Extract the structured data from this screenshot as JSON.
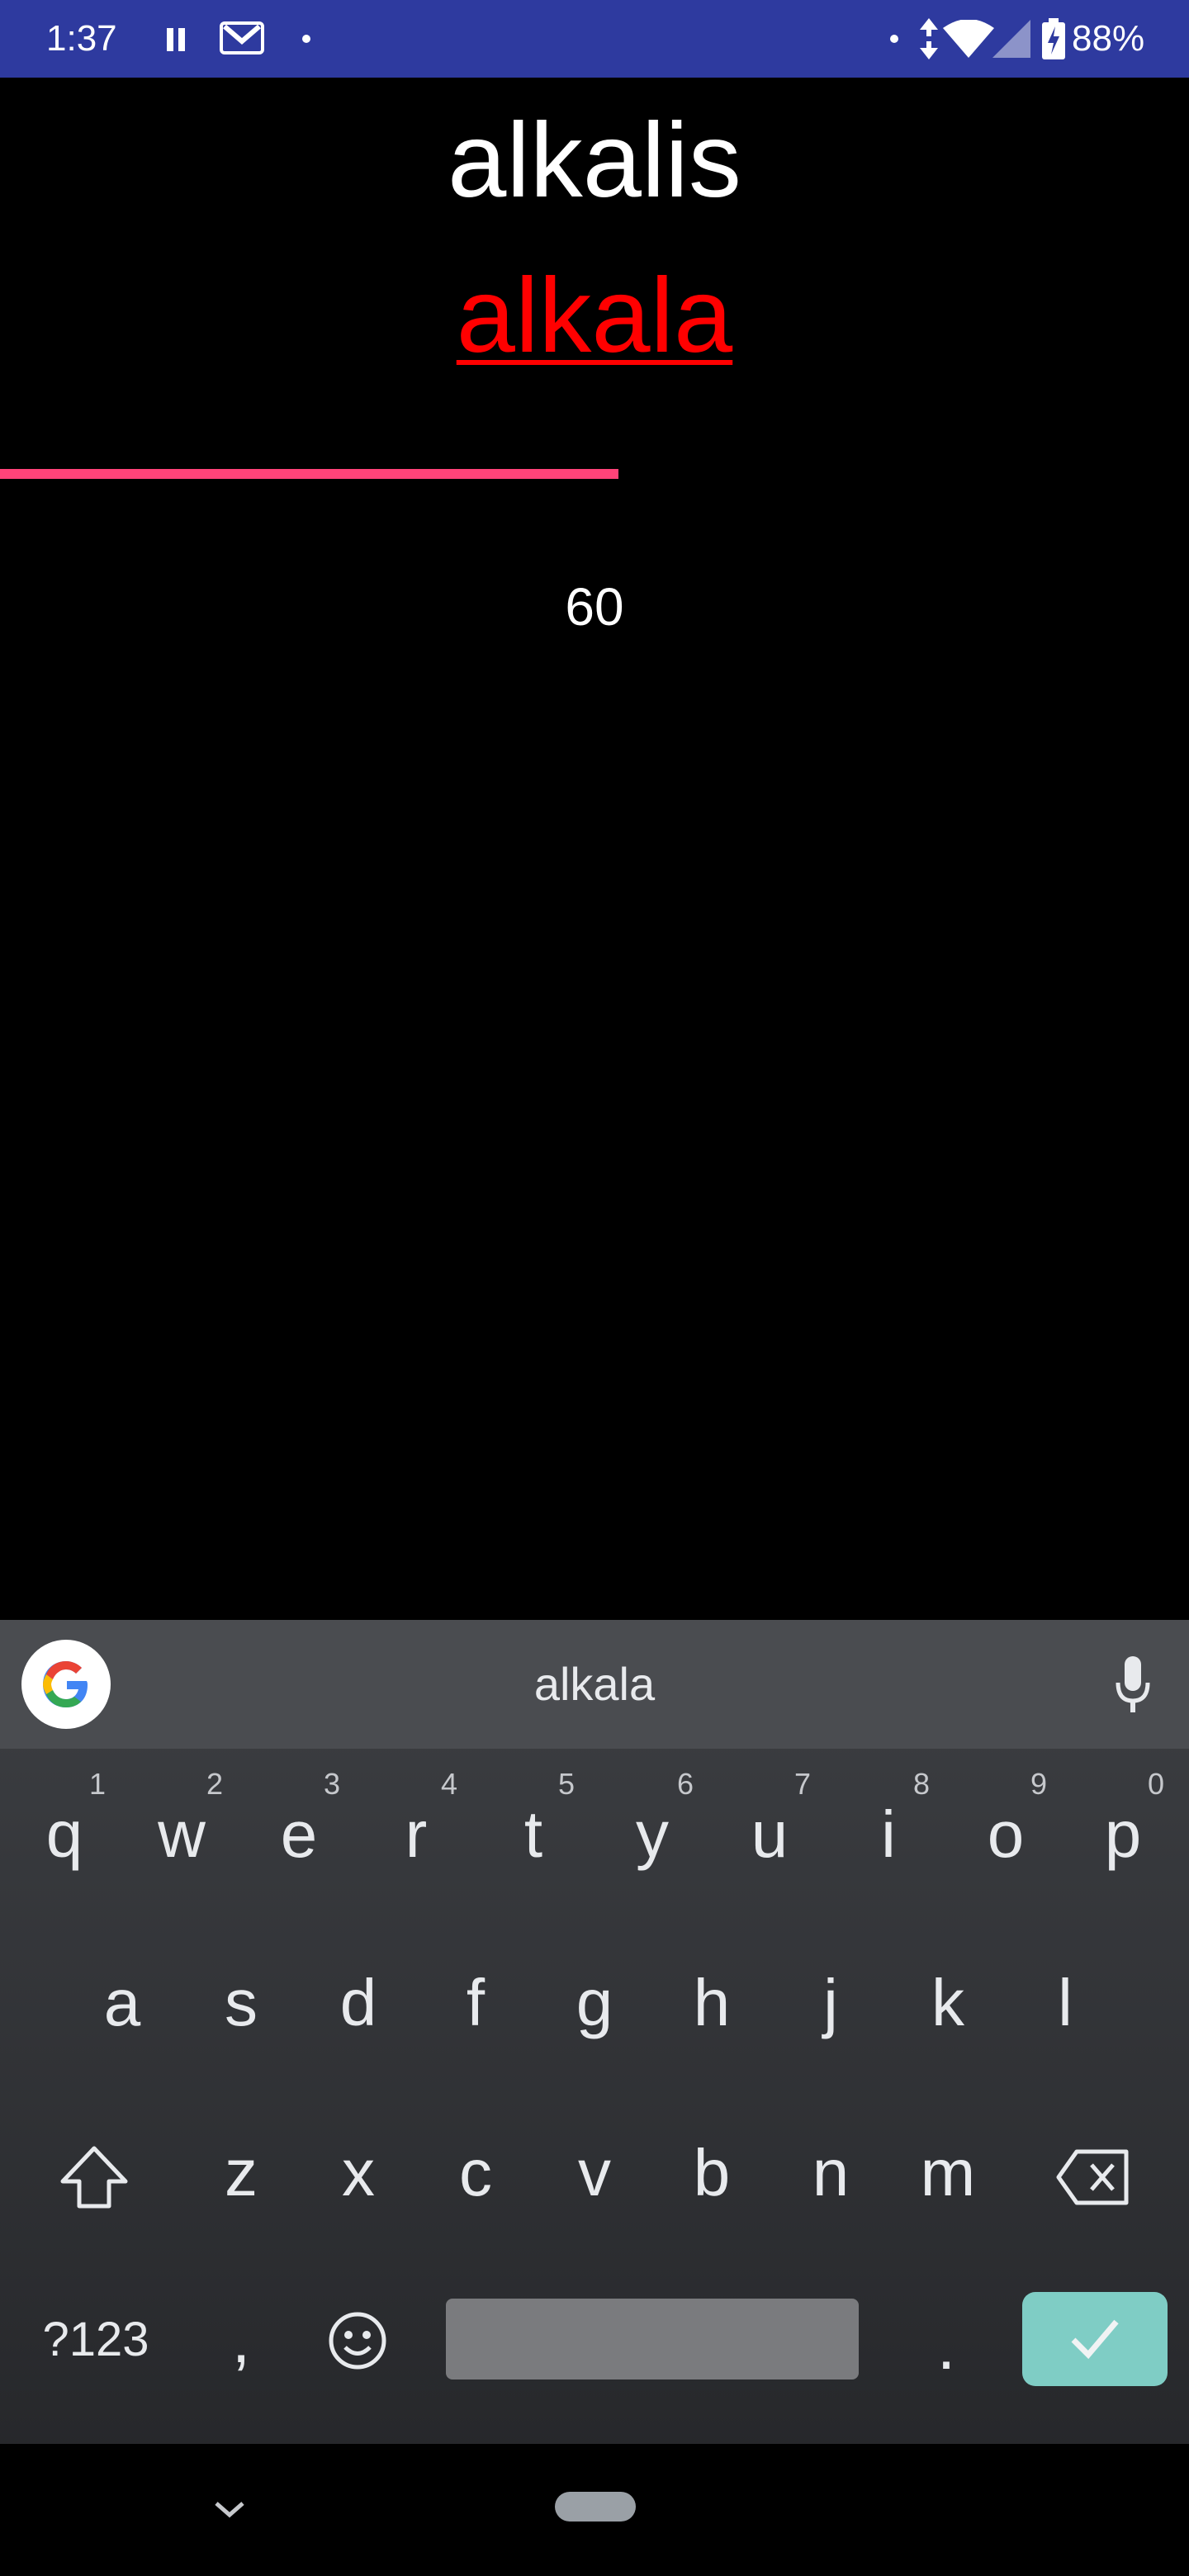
{
  "status_bar": {
    "time": "1:37",
    "battery": "88%",
    "icons": [
      "pause-icon",
      "gmail-icon",
      "dot-icon",
      "data-arrows-icon",
      "wifi-icon",
      "signal-icon",
      "battery-charging-icon"
    ],
    "color": "#2e3a9f"
  },
  "main": {
    "prompt_word": "alkalis",
    "answer_word": "alkala",
    "answer_color": "#ff0000",
    "progress_fraction": 0.52,
    "progress_color": "#ff4379",
    "timer": "60"
  },
  "keyboard": {
    "suggestion": "alkala",
    "row1": [
      {
        "key": "q",
        "hint": "1"
      },
      {
        "key": "w",
        "hint": "2"
      },
      {
        "key": "e",
        "hint": "3"
      },
      {
        "key": "r",
        "hint": "4"
      },
      {
        "key": "t",
        "hint": "5"
      },
      {
        "key": "y",
        "hint": "6"
      },
      {
        "key": "u",
        "hint": "7"
      },
      {
        "key": "i",
        "hint": "8"
      },
      {
        "key": "o",
        "hint": "9"
      },
      {
        "key": "p",
        "hint": "0"
      }
    ],
    "row2": [
      "a",
      "s",
      "d",
      "f",
      "g",
      "h",
      "j",
      "k",
      "l"
    ],
    "row3": [
      "z",
      "x",
      "c",
      "v",
      "b",
      "n",
      "m"
    ],
    "symbols_label": "?123",
    "comma": ",",
    "period": ".",
    "enter_color": "#7fcdc5"
  }
}
